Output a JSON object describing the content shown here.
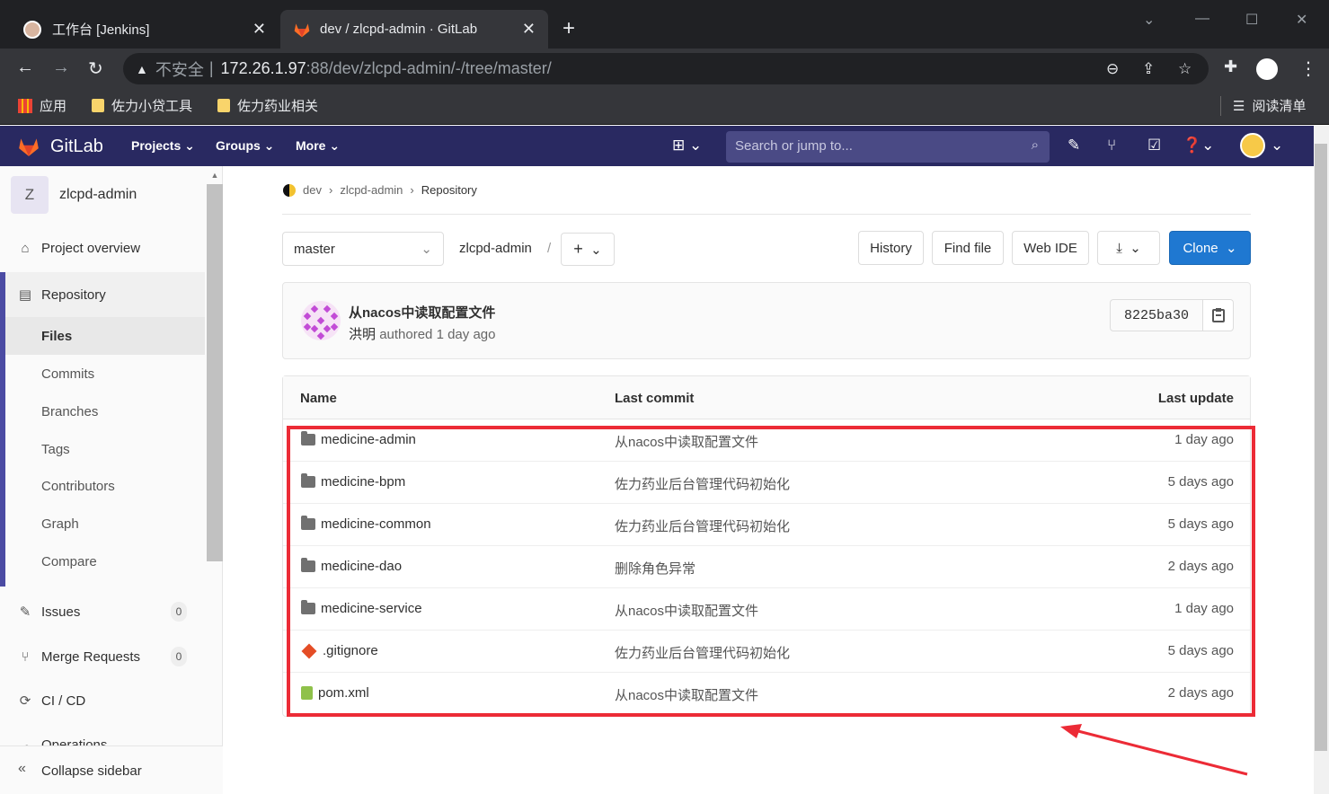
{
  "browser": {
    "tabs": [
      {
        "title": "工作台 [Jenkins]",
        "icon": "jenkins-icon"
      },
      {
        "title": "dev / zlcpd-admin · GitLab",
        "icon": "gitlab-icon"
      }
    ],
    "security_label": "不安全",
    "url_host": "172.26.1.97",
    "url_path": ":88/dev/zlcpd-admin/-/tree/master/",
    "bookmarks": [
      {
        "label": "应用"
      },
      {
        "label": "佐力小贷工具"
      },
      {
        "label": "佐力药业相关"
      }
    ],
    "reading_list": "阅读清单"
  },
  "gitlab": {
    "brand": "GitLab",
    "nav": {
      "projects": "Projects",
      "groups": "Groups",
      "more": "More"
    },
    "search_placeholder": "Search or jump to..."
  },
  "sidebar": {
    "project_initial": "Z",
    "project_name": "zlcpd-admin",
    "overview": "Project overview",
    "repository": "Repository",
    "sub": {
      "files": "Files",
      "commits": "Commits",
      "branches": "Branches",
      "tags": "Tags",
      "contributors": "Contributors",
      "graph": "Graph",
      "compare": "Compare"
    },
    "issues": "Issues",
    "issues_count": "0",
    "mr": "Merge Requests",
    "mr_count": "0",
    "cicd": "CI / CD",
    "operations": "Operations",
    "collapse": "Collapse sidebar"
  },
  "breadcrumb": {
    "group": "dev",
    "project": "zlcpd-admin",
    "current": "Repository"
  },
  "toolbar": {
    "branch": "master",
    "project": "zlcpd-admin",
    "slash": "/",
    "history": "History",
    "find_file": "Find file",
    "web_ide": "Web IDE",
    "clone": "Clone"
  },
  "last_commit": {
    "title": "从nacos中读取配置文件",
    "author": "洪明",
    "authored": "authored",
    "time": "1 day ago",
    "sha": "8225ba30"
  },
  "tree": {
    "headers": {
      "name": "Name",
      "last_commit": "Last commit",
      "last_update": "Last update"
    },
    "rows": [
      {
        "name": "medicine-admin",
        "type": "folder",
        "commit": "从nacos中读取配置文件",
        "updated": "1 day ago"
      },
      {
        "name": "medicine-bpm",
        "type": "folder",
        "commit": "佐力药业后台管理代码初始化",
        "updated": "5 days ago"
      },
      {
        "name": "medicine-common",
        "type": "folder",
        "commit": "佐力药业后台管理代码初始化",
        "updated": "5 days ago"
      },
      {
        "name": "medicine-dao",
        "type": "folder",
        "commit": "删除角色异常",
        "updated": "2 days ago"
      },
      {
        "name": "medicine-service",
        "type": "folder",
        "commit": "从nacos中读取配置文件",
        "updated": "1 day ago"
      },
      {
        "name": ".gitignore",
        "type": "git",
        "commit": "佐力药业后台管理代码初始化",
        "updated": "5 days ago"
      },
      {
        "name": "pom.xml",
        "type": "xml",
        "commit": "从nacos中读取配置文件",
        "updated": "2 days ago"
      }
    ]
  },
  "colors": {
    "header": "#292961",
    "accent": "#1f78d1",
    "highlight": "#ec2b36"
  }
}
